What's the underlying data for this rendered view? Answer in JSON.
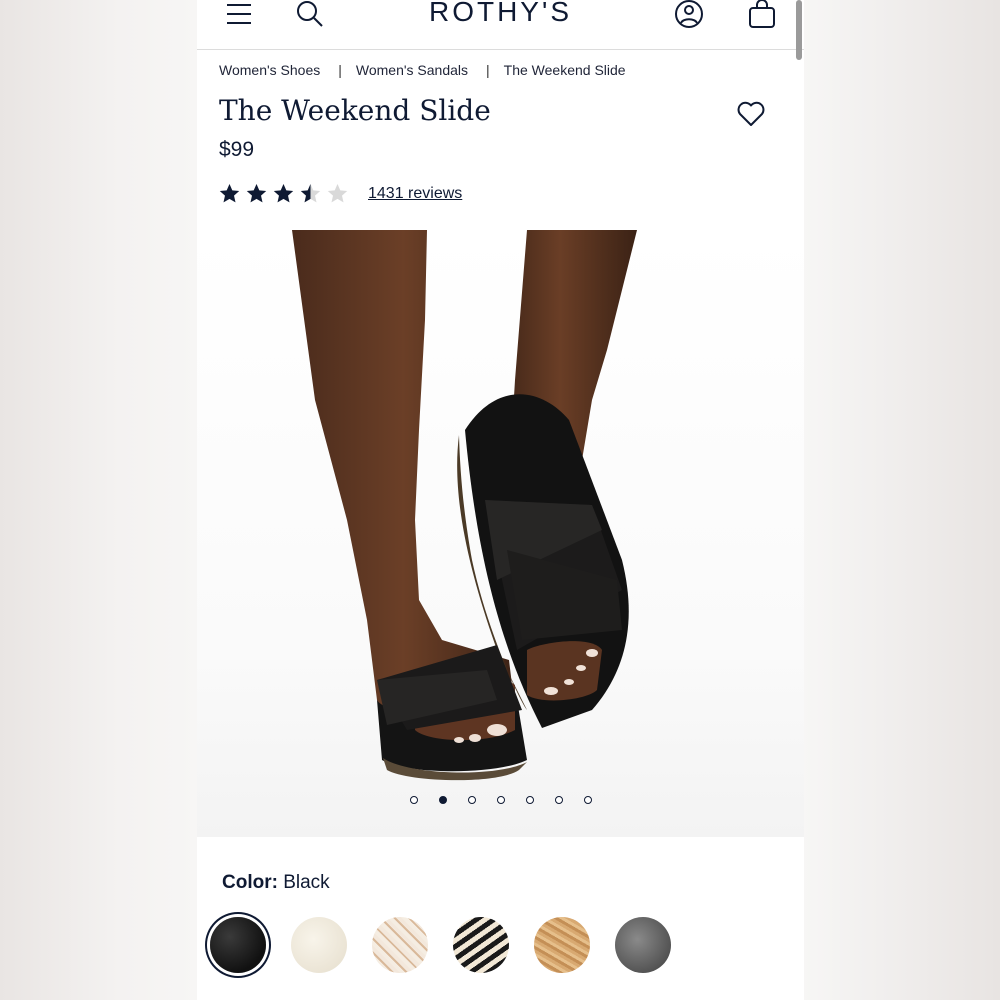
{
  "header": {
    "logo": "ROTHY'S",
    "icons": [
      "menu-icon",
      "search-icon",
      "account-icon",
      "bag-icon"
    ]
  },
  "breadcrumb": [
    "Women's Shoes",
    "Women's Sandals",
    "The Weekend Slide"
  ],
  "product": {
    "title": "The Weekend Slide",
    "price": "$99",
    "rating": 3.5,
    "rating_max": 5,
    "reviews_label": "1431 reviews"
  },
  "gallery": {
    "image_count": 7,
    "active_index": 1
  },
  "color": {
    "label": "Color:",
    "selected": "Black",
    "swatches": [
      "black",
      "cream",
      "woven-neutral",
      "black-cream-stripe",
      "natural-raffia",
      "grey"
    ]
  },
  "colors": {
    "text": "#0f1a33",
    "star_filled": "#0f1a33",
    "star_empty": "#d9d9d9"
  }
}
